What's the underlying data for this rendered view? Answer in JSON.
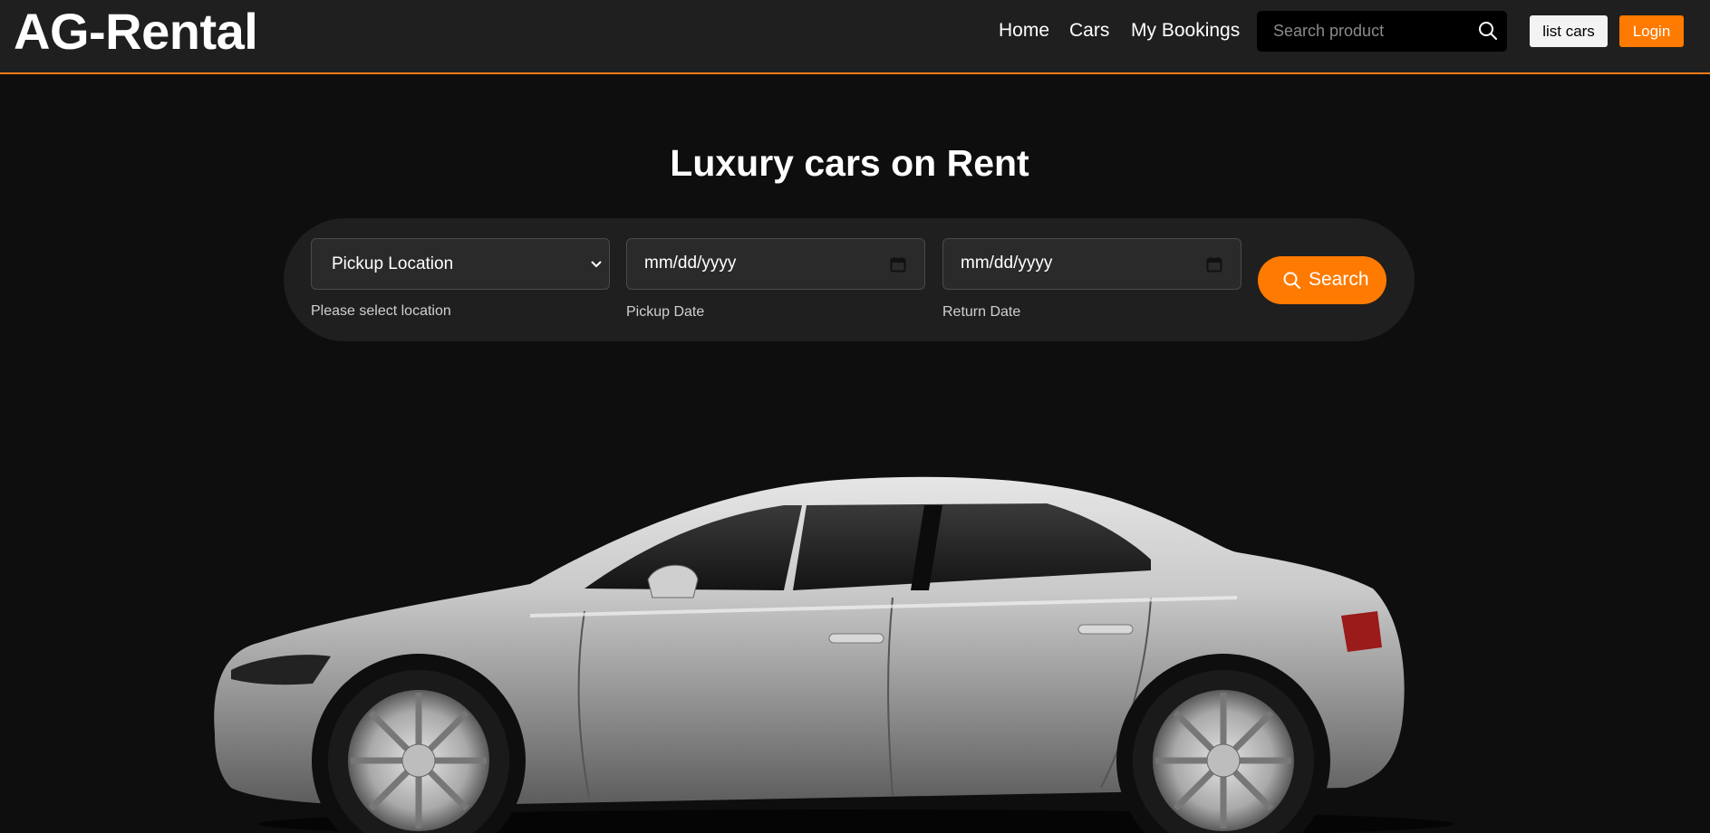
{
  "header": {
    "logo": "AG-Rental",
    "nav": [
      {
        "label": "Home"
      },
      {
        "label": "Cars"
      },
      {
        "label": "My Bookings"
      }
    ],
    "search": {
      "placeholder": "Search product",
      "icon": "search-icon"
    },
    "list_cars_label": "list cars",
    "login_label": "Login"
  },
  "hero": {
    "title": "Luxury cars on Rent",
    "location": {
      "selected": "Pickup Location",
      "helper": "Please select location"
    },
    "pickup_date": {
      "value": "mm/dd/yyyy",
      "helper": "Pickup Date",
      "icon": "calendar-icon"
    },
    "return_date": {
      "value": "mm/dd/yyyy",
      "helper": "Return Date",
      "icon": "calendar-icon"
    },
    "search_label": "Search"
  },
  "colors": {
    "accent": "#ff7a00",
    "header_bg": "#1f1f1f",
    "page_bg": "#0e0e0e",
    "panel_bg": "#1f1f1f"
  }
}
